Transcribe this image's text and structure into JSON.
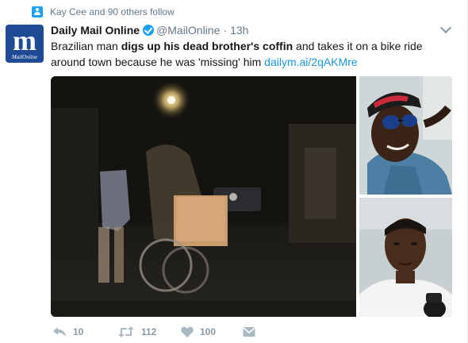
{
  "social_context": {
    "text": "Kay Cee and 90 others follow",
    "icon": "person-icon"
  },
  "avatar": {
    "letter": "m",
    "brand": "MailOnline"
  },
  "tweet": {
    "author_name": "Daily Mail Online",
    "handle": "@MailOnline",
    "separator": "·",
    "time": "13h",
    "text_pre": "Brazilian man ",
    "text_bold_1": "digs up his dead brother's coffin",
    "text_mid": " and takes it on a bike ride around town because he was 'missing' him ",
    "link": "dailym.ai/2qAKMre"
  },
  "actions": {
    "reply_count": "10",
    "retweet_count": "112",
    "like_count": "100"
  },
  "colors": {
    "accent": "#1da1f2",
    "link": "#1b95e0",
    "muted": "#657786",
    "brand_blue": "#1f4a96"
  }
}
